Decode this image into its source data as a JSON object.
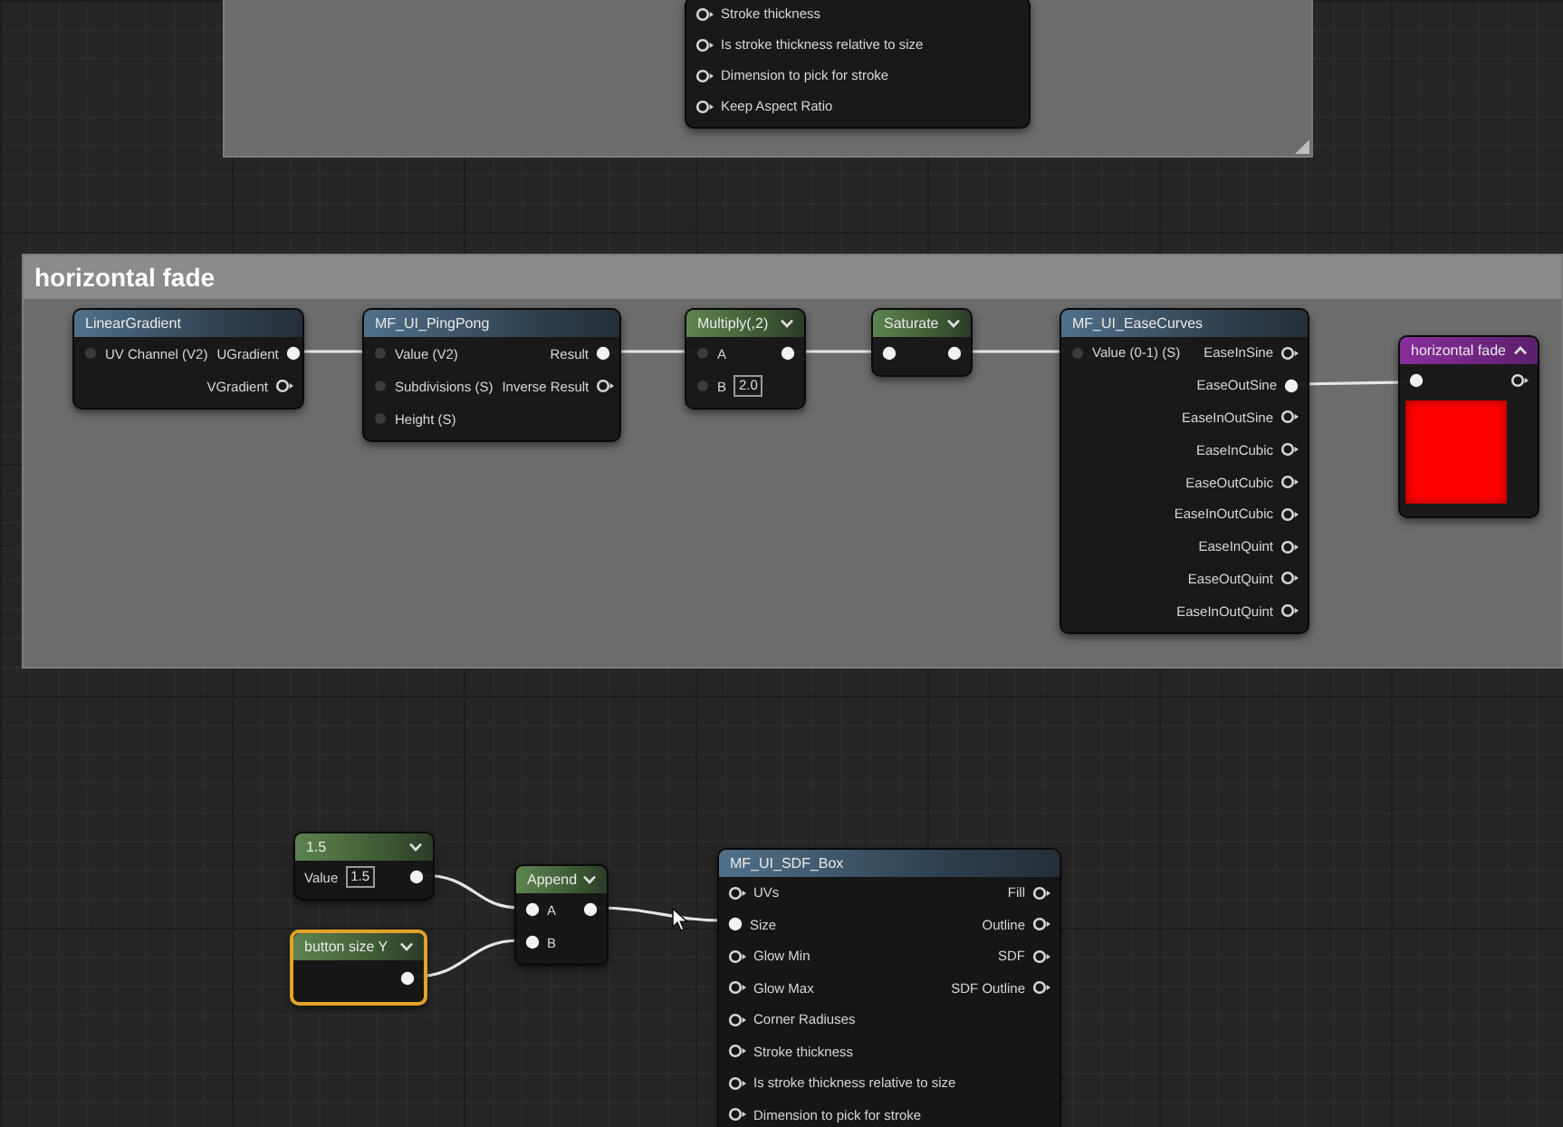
{
  "comments": [
    {
      "nodes": [
        {
          "kind": "function",
          "selected": false,
          "rows": [
            {
              "input": {
                "label": "Stroke thickness",
                "kind": "hollow"
              }
            },
            {
              "input": {
                "label": "Is stroke thickness relative to size",
                "kind": "hollow"
              }
            },
            {
              "input": {
                "label": "Dimension to pick for stroke",
                "kind": "hollow"
              }
            },
            {
              "input": {
                "label": "Keep Aspect Ratio",
                "kind": "hollow"
              }
            }
          ]
        }
      ]
    },
    {
      "title": "horizontal fade",
      "nodes": [
        {
          "kind": "function",
          "title": "LinearGradient",
          "selected": false,
          "rows": [
            {
              "input": {
                "label": "UV Channel (V2)",
                "kind": "dim"
              },
              "output": {
                "label": "UGradient",
                "kind": "filled"
              }
            },
            {
              "output": {
                "label": "VGradient",
                "kind": "hollow"
              }
            }
          ]
        },
        {
          "kind": "function",
          "title": "MF_UI_PingPong",
          "selected": false,
          "rows": [
            {
              "input": {
                "label": "Value (V2)",
                "kind": "dim"
              },
              "output": {
                "label": "Result",
                "kind": "filled"
              }
            },
            {
              "input": {
                "label": "Subdivisions (S)",
                "kind": "dim"
              },
              "output": {
                "label": "Inverse Result",
                "kind": "hollow"
              }
            },
            {
              "input": {
                "label": "Height (S)",
                "kind": "dim"
              }
            }
          ]
        },
        {
          "kind": "math",
          "title": "Multiply(,2)",
          "selected": false,
          "rows": [
            {
              "input": {
                "label": "A",
                "kind": "dim"
              },
              "output": {
                "kind": "filled"
              }
            },
            {
              "input": {
                "label": "B",
                "kind": "dim",
                "value": "2.0"
              }
            }
          ]
        },
        {
          "kind": "math",
          "title": "Saturate",
          "selected": false,
          "rows": [
            {
              "input": {
                "kind": "filled"
              },
              "output": {
                "kind": "filled"
              }
            }
          ]
        },
        {
          "kind": "function",
          "title": "MF_UI_EaseCurves",
          "selected": false,
          "rows": [
            {
              "input": {
                "label": "Value (0-1) (S)",
                "kind": "dim"
              },
              "output": {
                "label": "EaseInSine",
                "kind": "hollow"
              }
            },
            {
              "output": {
                "label": "EaseOutSine",
                "kind": "filled"
              }
            },
            {
              "output": {
                "label": "EaseInOutSine",
                "kind": "hollow"
              }
            },
            {
              "output": {
                "label": "EaseInCubic",
                "kind": "hollow"
              }
            },
            {
              "output": {
                "label": "EaseOutCubic",
                "kind": "hollow"
              }
            },
            {
              "output": {
                "label": "EaseInOutCubic",
                "kind": "hollow"
              }
            },
            {
              "output": {
                "label": "EaseInQuint",
                "kind": "hollow"
              }
            },
            {
              "output": {
                "label": "EaseOutQuint",
                "kind": "hollow"
              }
            },
            {
              "output": {
                "label": "EaseInOutQuint",
                "kind": "hollow"
              }
            }
          ]
        },
        {
          "kind": "result",
          "title": "horizontal fade",
          "selected": false,
          "rows": [
            {
              "input": {
                "kind": "filled"
              },
              "output": {
                "kind": "hollow"
              }
            }
          ]
        }
      ]
    }
  ],
  "nodes": [
    {
      "kind": "constant",
      "title": "1.5",
      "selected": false,
      "rows": [
        {
          "input": {
            "label": "Value",
            "value": "1.5"
          },
          "output": {
            "kind": "filled"
          }
        }
      ]
    },
    {
      "kind": "constant",
      "title": "button size Y",
      "selected": true,
      "rows": [
        {
          "output": {
            "kind": "filled"
          }
        }
      ]
    },
    {
      "kind": "math",
      "title": "Append",
      "selected": false,
      "rows": [
        {
          "input": {
            "label": "A",
            "kind": "filled"
          },
          "output": {
            "kind": "filled"
          }
        },
        {
          "input": {
            "label": "B",
            "kind": "filled"
          }
        }
      ]
    },
    {
      "kind": "function",
      "title": "MF_UI_SDF_Box",
      "selected": false,
      "rows": [
        {
          "input": {
            "label": "UVs",
            "kind": "hollow"
          },
          "output": {
            "label": "Fill",
            "kind": "hollow"
          }
        },
        {
          "input": {
            "label": "Size",
            "kind": "filled"
          },
          "output": {
            "label": "Outline",
            "kind": "hollow"
          }
        },
        {
          "input": {
            "label": "Glow Min",
            "kind": "hollow"
          },
          "output": {
            "label": "SDF",
            "kind": "hollow"
          }
        },
        {
          "input": {
            "label": "Glow Max",
            "kind": "hollow"
          },
          "output": {
            "label": "SDF Outline",
            "kind": "hollow"
          }
        },
        {
          "input": {
            "label": "Corner Radiuses",
            "kind": "hollow"
          }
        },
        {
          "input": {
            "label": "Stroke thickness",
            "kind": "hollow"
          }
        },
        {
          "input": {
            "label": "Is stroke thickness relative to size",
            "kind": "hollow"
          }
        },
        {
          "input": {
            "label": "Dimension to pick for stroke",
            "kind": "hollow"
          }
        }
      ]
    }
  ]
}
